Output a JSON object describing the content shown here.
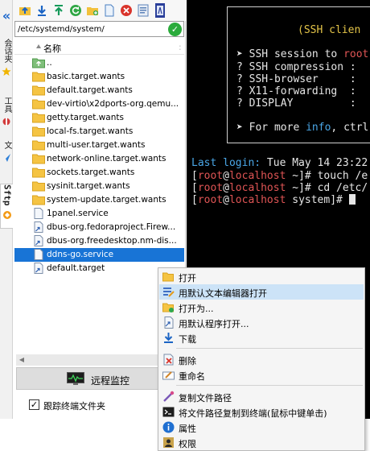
{
  "vertical_tabs": {
    "sessions_label": "会话夹",
    "tools_label": "工具",
    "files_label": "文",
    "sftp_label": "Sftp"
  },
  "toolbar": {
    "icons": [
      "upload-icon",
      "download-icon",
      "upload-up-icon",
      "refresh-icon",
      "new-folder-icon",
      "new-file-icon",
      "delete-icon",
      "properties-icon",
      "text-editor-icon"
    ]
  },
  "path": {
    "value": "/etc/systemd/system/"
  },
  "columns": {
    "name": "名称"
  },
  "files": [
    {
      "name": "..",
      "type": "up"
    },
    {
      "name": "basic.target.wants",
      "type": "folder"
    },
    {
      "name": "default.target.wants",
      "type": "folder"
    },
    {
      "name": "dev-virtio\\x2dports-org.qemu...",
      "type": "folder"
    },
    {
      "name": "getty.target.wants",
      "type": "folder"
    },
    {
      "name": "local-fs.target.wants",
      "type": "folder"
    },
    {
      "name": "multi-user.target.wants",
      "type": "folder"
    },
    {
      "name": "network-online.target.wants",
      "type": "folder"
    },
    {
      "name": "sockets.target.wants",
      "type": "folder"
    },
    {
      "name": "sysinit.target.wants",
      "type": "folder"
    },
    {
      "name": "system-update.target.wants",
      "type": "folder"
    },
    {
      "name": "1panel.service",
      "type": "file"
    },
    {
      "name": "dbus-org.fedoraproject.Firew...",
      "type": "link"
    },
    {
      "name": "dbus-org.freedesktop.nm-dis...",
      "type": "link"
    },
    {
      "name": "ddns-go.service",
      "type": "file",
      "selected": true
    },
    {
      "name": "default.target",
      "type": "link"
    }
  ],
  "monitor": {
    "label": "远程监控"
  },
  "follow": {
    "label": "跟踪终端文件夹",
    "checked": true
  },
  "terminal": {
    "banner_title": "(SSH clien",
    "banner_lines": [
      {
        "bullet": "➤",
        "text": "SSH session to ",
        "highlight": "root",
        "highlight_color": "red"
      },
      {
        "bullet": "?",
        "text": "SSH compression",
        "suffix": " :"
      },
      {
        "bullet": "?",
        "text": "SSH-browser",
        "suffix": "     :"
      },
      {
        "bullet": "?",
        "text": "X11-forwarding",
        "suffix": "  :"
      },
      {
        "bullet": "?",
        "text": "DISPLAY",
        "suffix": "         :"
      },
      {
        "bullet": "➤",
        "text": "For more ",
        "highlight": "info",
        "highlight_color": "cyan",
        "after": ", ctrl"
      }
    ],
    "last_login_label": "Last login:",
    "last_login_value": " Tue May 14 23:22",
    "prompt_user": "root",
    "prompt_host": "localhost",
    "commands": [
      {
        "dir": "~",
        "cmd": "touch /e"
      },
      {
        "dir": "~",
        "cmd": "cd /etc/"
      },
      {
        "dir": "system",
        "cmd": ""
      }
    ]
  },
  "context_menu": {
    "items": [
      {
        "label": "打开",
        "icon": "folder-open-icon"
      },
      {
        "label": "用默认文本编辑器打开",
        "icon": "text-editor-icon",
        "highlighted": true
      },
      {
        "label": "打开为...",
        "icon": "open-as-icon"
      },
      {
        "label": "用默认程序打开...",
        "icon": "default-program-icon"
      },
      {
        "label": "下载",
        "icon": "download-icon"
      },
      {
        "label": "删除",
        "icon": "delete-icon"
      },
      {
        "label": "重命名",
        "icon": "rename-icon"
      },
      {
        "label": "复制文件路径",
        "icon": "copy-path-icon"
      },
      {
        "label": "将文件路径复制到终端(鼠标中键单击)",
        "icon": "terminal-icon"
      },
      {
        "label": "属性",
        "icon": "info-icon"
      },
      {
        "label": "权限",
        "icon": "permissions-icon"
      }
    ]
  }
}
